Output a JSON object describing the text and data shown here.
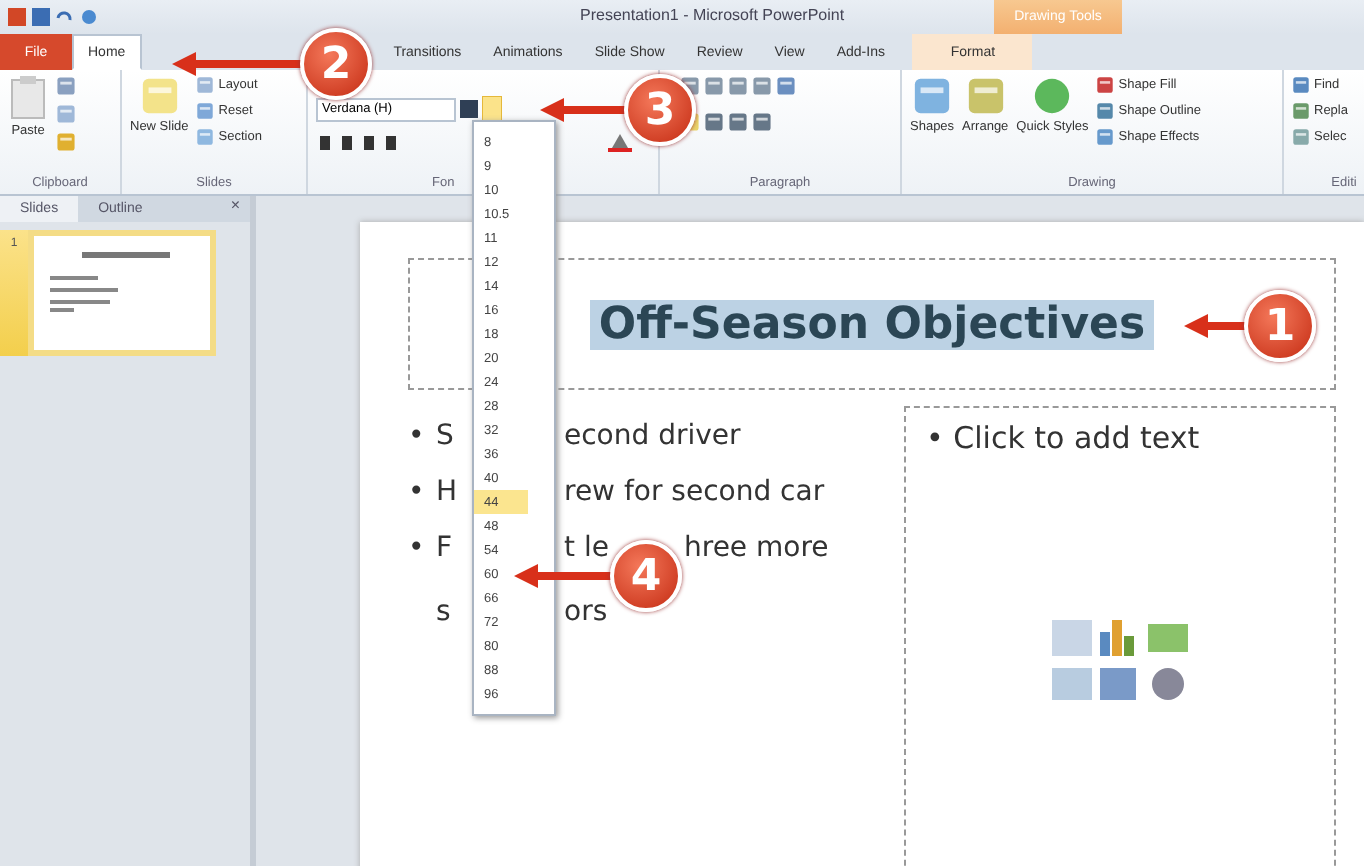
{
  "window": {
    "title": "Presentation1 - Microsoft PowerPoint",
    "context_tab": "Drawing Tools"
  },
  "tabs": [
    {
      "label": "File",
      "selected": false,
      "kind": "file"
    },
    {
      "label": "Home",
      "selected": true,
      "kind": "tab"
    },
    {
      "label": "Transitions",
      "selected": false,
      "kind": "tab"
    },
    {
      "label": "Animations",
      "selected": false,
      "kind": "tab"
    },
    {
      "label": "Slide Show",
      "selected": false,
      "kind": "tab"
    },
    {
      "label": "Review",
      "selected": false,
      "kind": "tab"
    },
    {
      "label": "View",
      "selected": false,
      "kind": "tab"
    },
    {
      "label": "Add-Ins",
      "selected": false,
      "kind": "tab"
    },
    {
      "label": "Format",
      "selected": false,
      "kind": "context"
    }
  ],
  "ribbon": {
    "clipboard": {
      "paste": "Paste",
      "label": "Clipboard"
    },
    "slides": {
      "new_slide": "New Slide",
      "layout": "Layout",
      "reset": "Reset",
      "section": "Section",
      "label": "Slides"
    },
    "font": {
      "font_name": "Verdana (H)",
      "label": "Fon"
    },
    "paragraph": {
      "label": "Paragraph"
    },
    "drawing": {
      "shapes": "Shapes",
      "arrange": "Arrange",
      "quick_styles": "Quick Styles",
      "shape_fill": "Shape Fill",
      "shape_outline": "Shape Outline",
      "shape_effects": "Shape Effects",
      "label": "Drawing"
    },
    "editing": {
      "find": "Find",
      "replace": "Repla",
      "select": "Selec",
      "label": "Editi"
    }
  },
  "pane_tabs": [
    {
      "label": "Slides",
      "selected": true
    },
    {
      "label": "Outline",
      "selected": false
    }
  ],
  "pane_close": "×",
  "thumbnail": {
    "number": "1"
  },
  "slide": {
    "title": "Off-Season Objectives",
    "bullets": [
      {
        "bullet": "•",
        "parts": [
          "S",
          "econd driver"
        ]
      },
      {
        "bullet": "•",
        "parts": [
          "H",
          "rew for second car"
        ]
      },
      {
        "bullet": "•",
        "parts": [
          "F",
          "t le",
          "hree more"
        ]
      },
      {
        "parts": [
          "s",
          "ors"
        ]
      }
    ],
    "placeholder_bullet": "•",
    "placeholder": "Click to add text"
  },
  "font_sizes": [
    {
      "label": "8",
      "selected": false
    },
    {
      "label": "9",
      "selected": false
    },
    {
      "label": "10",
      "selected": false
    },
    {
      "label": "10.5",
      "selected": false
    },
    {
      "label": "11",
      "selected": false
    },
    {
      "label": "12",
      "selected": false
    },
    {
      "label": "14",
      "selected": false
    },
    {
      "label": "16",
      "selected": false
    },
    {
      "label": "18",
      "selected": false
    },
    {
      "label": "20",
      "selected": false
    },
    {
      "label": "24",
      "selected": false
    },
    {
      "label": "28",
      "selected": false
    },
    {
      "label": "32",
      "selected": false
    },
    {
      "label": "36",
      "selected": false
    },
    {
      "label": "40",
      "selected": false
    },
    {
      "label": "44",
      "selected": true
    },
    {
      "label": "48",
      "selected": false
    },
    {
      "label": "54",
      "selected": false
    },
    {
      "label": "60",
      "selected": false
    },
    {
      "label": "66",
      "selected": false
    },
    {
      "label": "72",
      "selected": false
    },
    {
      "label": "80",
      "selected": false
    },
    {
      "label": "88",
      "selected": false
    },
    {
      "label": "96",
      "selected": false
    }
  ],
  "callouts": [
    {
      "number": "1"
    },
    {
      "number": "2"
    },
    {
      "number": "3"
    },
    {
      "number": "4"
    }
  ]
}
